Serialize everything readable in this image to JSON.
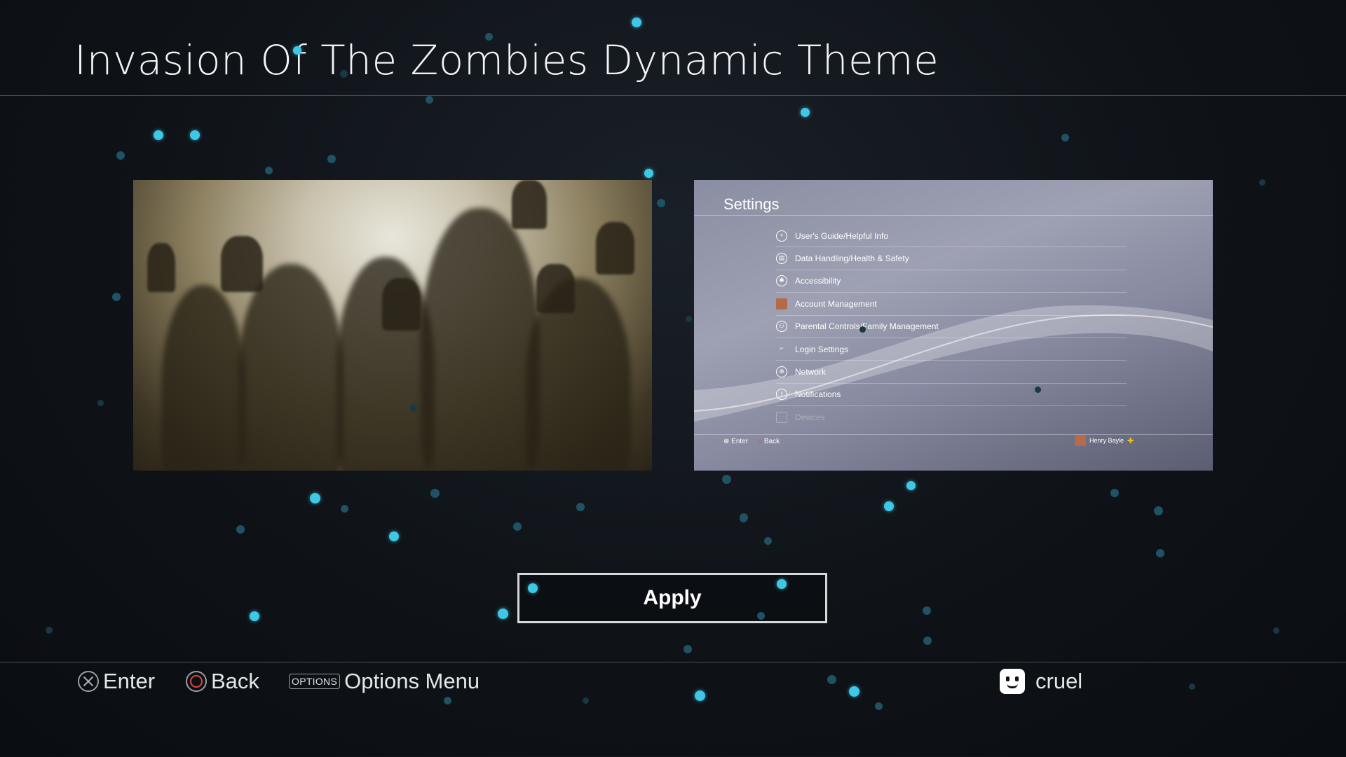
{
  "header": {
    "title": "Invasion Of The Zombies Dynamic Theme"
  },
  "preview_settings": {
    "title": "Settings",
    "items": [
      {
        "label": "User's Guide/Helpful Info",
        "icon": "help-icon"
      },
      {
        "label": "Data Handling/Health & Safety",
        "icon": "data-handling-icon"
      },
      {
        "label": "Accessibility",
        "icon": "accessibility-icon"
      },
      {
        "label": "Account Management",
        "icon": "account-icon"
      },
      {
        "label": "Parental Controls/Family Management",
        "icon": "parental-controls-icon"
      },
      {
        "label": "Login Settings",
        "icon": "login-icon"
      },
      {
        "label": "Network",
        "icon": "globe-icon"
      },
      {
        "label": "Notifications",
        "icon": "info-icon"
      },
      {
        "label": "Devices",
        "icon": "devices-icon"
      }
    ],
    "footer_enter": "Enter",
    "footer_back": "Back",
    "user_name": "Henry Bayle"
  },
  "apply_label": "Apply",
  "footer": {
    "enter_label": "Enter",
    "back_label": "Back",
    "options_key": "OPTIONS",
    "options_label": "Options Menu",
    "user_name": "cruel"
  },
  "colors": {
    "accent_particle": "#3ec8e6",
    "background": "#0f1318",
    "circle_red": "#e0453a"
  }
}
